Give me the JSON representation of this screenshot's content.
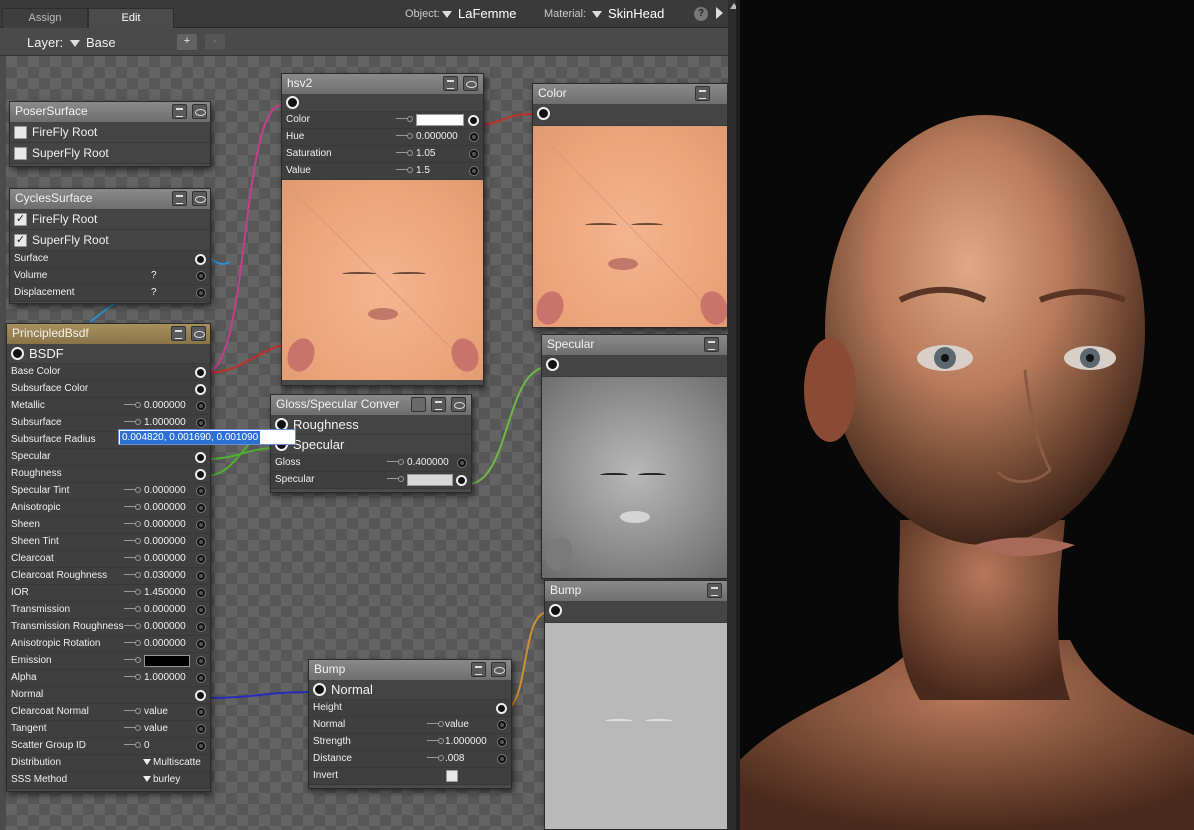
{
  "tabs": [
    "Assign",
    "Edit"
  ],
  "header": {
    "object_label": "Object:",
    "object_value": "LaFemme",
    "material_label": "Material:",
    "material_value": "SkinHead",
    "help": "?"
  },
  "layer": {
    "label": "Layer:",
    "value": "Base",
    "add": "+",
    "remove": "-"
  },
  "edit_field": {
    "value": "0.004820, 0.001690, 0.001090"
  },
  "nodes": {
    "poser_surface": {
      "title": "PoserSurface",
      "rows": [
        "FireFly Root",
        "SuperFly Root"
      ]
    },
    "cycles_surface": {
      "title": "CyclesSurface",
      "checks": [
        "FireFly Root",
        "SuperFly Root"
      ],
      "rows": [
        {
          "label": "Surface",
          "value": ""
        },
        {
          "label": "Volume",
          "value": "?"
        },
        {
          "label": "Displacement",
          "value": "?"
        }
      ]
    },
    "principled": {
      "title": "PrincipledBsdf",
      "output": "BSDF",
      "rows": [
        {
          "label": "Base Color",
          "value": ""
        },
        {
          "label": "Subsurface Color",
          "value": ""
        },
        {
          "label": "Metallic",
          "value": "0.000000"
        },
        {
          "label": "Subsurface",
          "value": "1.000000"
        },
        {
          "label": "Subsurface Radius",
          "value": ""
        },
        {
          "label": "Specular",
          "value": ""
        },
        {
          "label": "Roughness",
          "value": ""
        },
        {
          "label": "Specular Tint",
          "value": "0.000000"
        },
        {
          "label": "Anisotropic",
          "value": "0.000000"
        },
        {
          "label": "Sheen",
          "value": "0.000000"
        },
        {
          "label": "Sheen Tint",
          "value": "0.000000"
        },
        {
          "label": "Clearcoat",
          "value": "0.000000"
        },
        {
          "label": "Clearcoat Roughness",
          "value": "0.030000"
        },
        {
          "label": "IOR",
          "value": "1.450000"
        },
        {
          "label": "Transmission",
          "value": "0.000000"
        },
        {
          "label": "Transmission Roughness",
          "value": "0.000000"
        },
        {
          "label": "Anisotropic Rotation",
          "value": "0.000000"
        },
        {
          "label": "Emission",
          "value": ""
        },
        {
          "label": "Alpha",
          "value": "1.000000"
        },
        {
          "label": "Normal",
          "value": ""
        },
        {
          "label": "Clearcoat Normal",
          "value": "value"
        },
        {
          "label": "Tangent",
          "value": "value"
        },
        {
          "label": "Scatter Group ID",
          "value": "0"
        },
        {
          "label": "Distribution",
          "value": "Multiscatte"
        },
        {
          "label": "SSS Method",
          "value": "burley"
        }
      ]
    },
    "hsv2": {
      "title": "hsv2",
      "rows": [
        {
          "label": "Color",
          "value": ""
        },
        {
          "label": "Hue",
          "value": "0.000000"
        },
        {
          "label": "Saturation",
          "value": "1.05"
        },
        {
          "label": "Value",
          "value": "1.5"
        }
      ]
    },
    "color": {
      "title": "Color"
    },
    "gloss_spec": {
      "title": "Gloss/Specular Conver",
      "outputs": [
        "Roughness",
        "Specular"
      ],
      "rows": [
        {
          "label": "Gloss",
          "value": "0.400000"
        },
        {
          "label": "Specular",
          "value": ""
        }
      ]
    },
    "specular": {
      "title": "Specular"
    },
    "bump_tex": {
      "title": "Bump"
    },
    "bump": {
      "title": "Bump",
      "output": "Normal",
      "rows": [
        {
          "label": "Height",
          "value": ""
        },
        {
          "label": "Normal",
          "value": "value"
        },
        {
          "label": "Strength",
          "value": "1.000000"
        },
        {
          "label": "Distance",
          "value": ".008"
        },
        {
          "label": "Invert",
          "value": ""
        }
      ]
    }
  },
  "colors": {
    "wire_pink": "#c0408c",
    "wire_red": "#c0302a",
    "wire_blue": "#2a5fc0",
    "wire_lightblue": "#2d8fd0",
    "wire_green": "#4fb030",
    "wire_orange": "#d09030",
    "wire_navy": "#2a2ab8",
    "principled_header": "#a88f5e",
    "selection": "#2e6fd3"
  }
}
